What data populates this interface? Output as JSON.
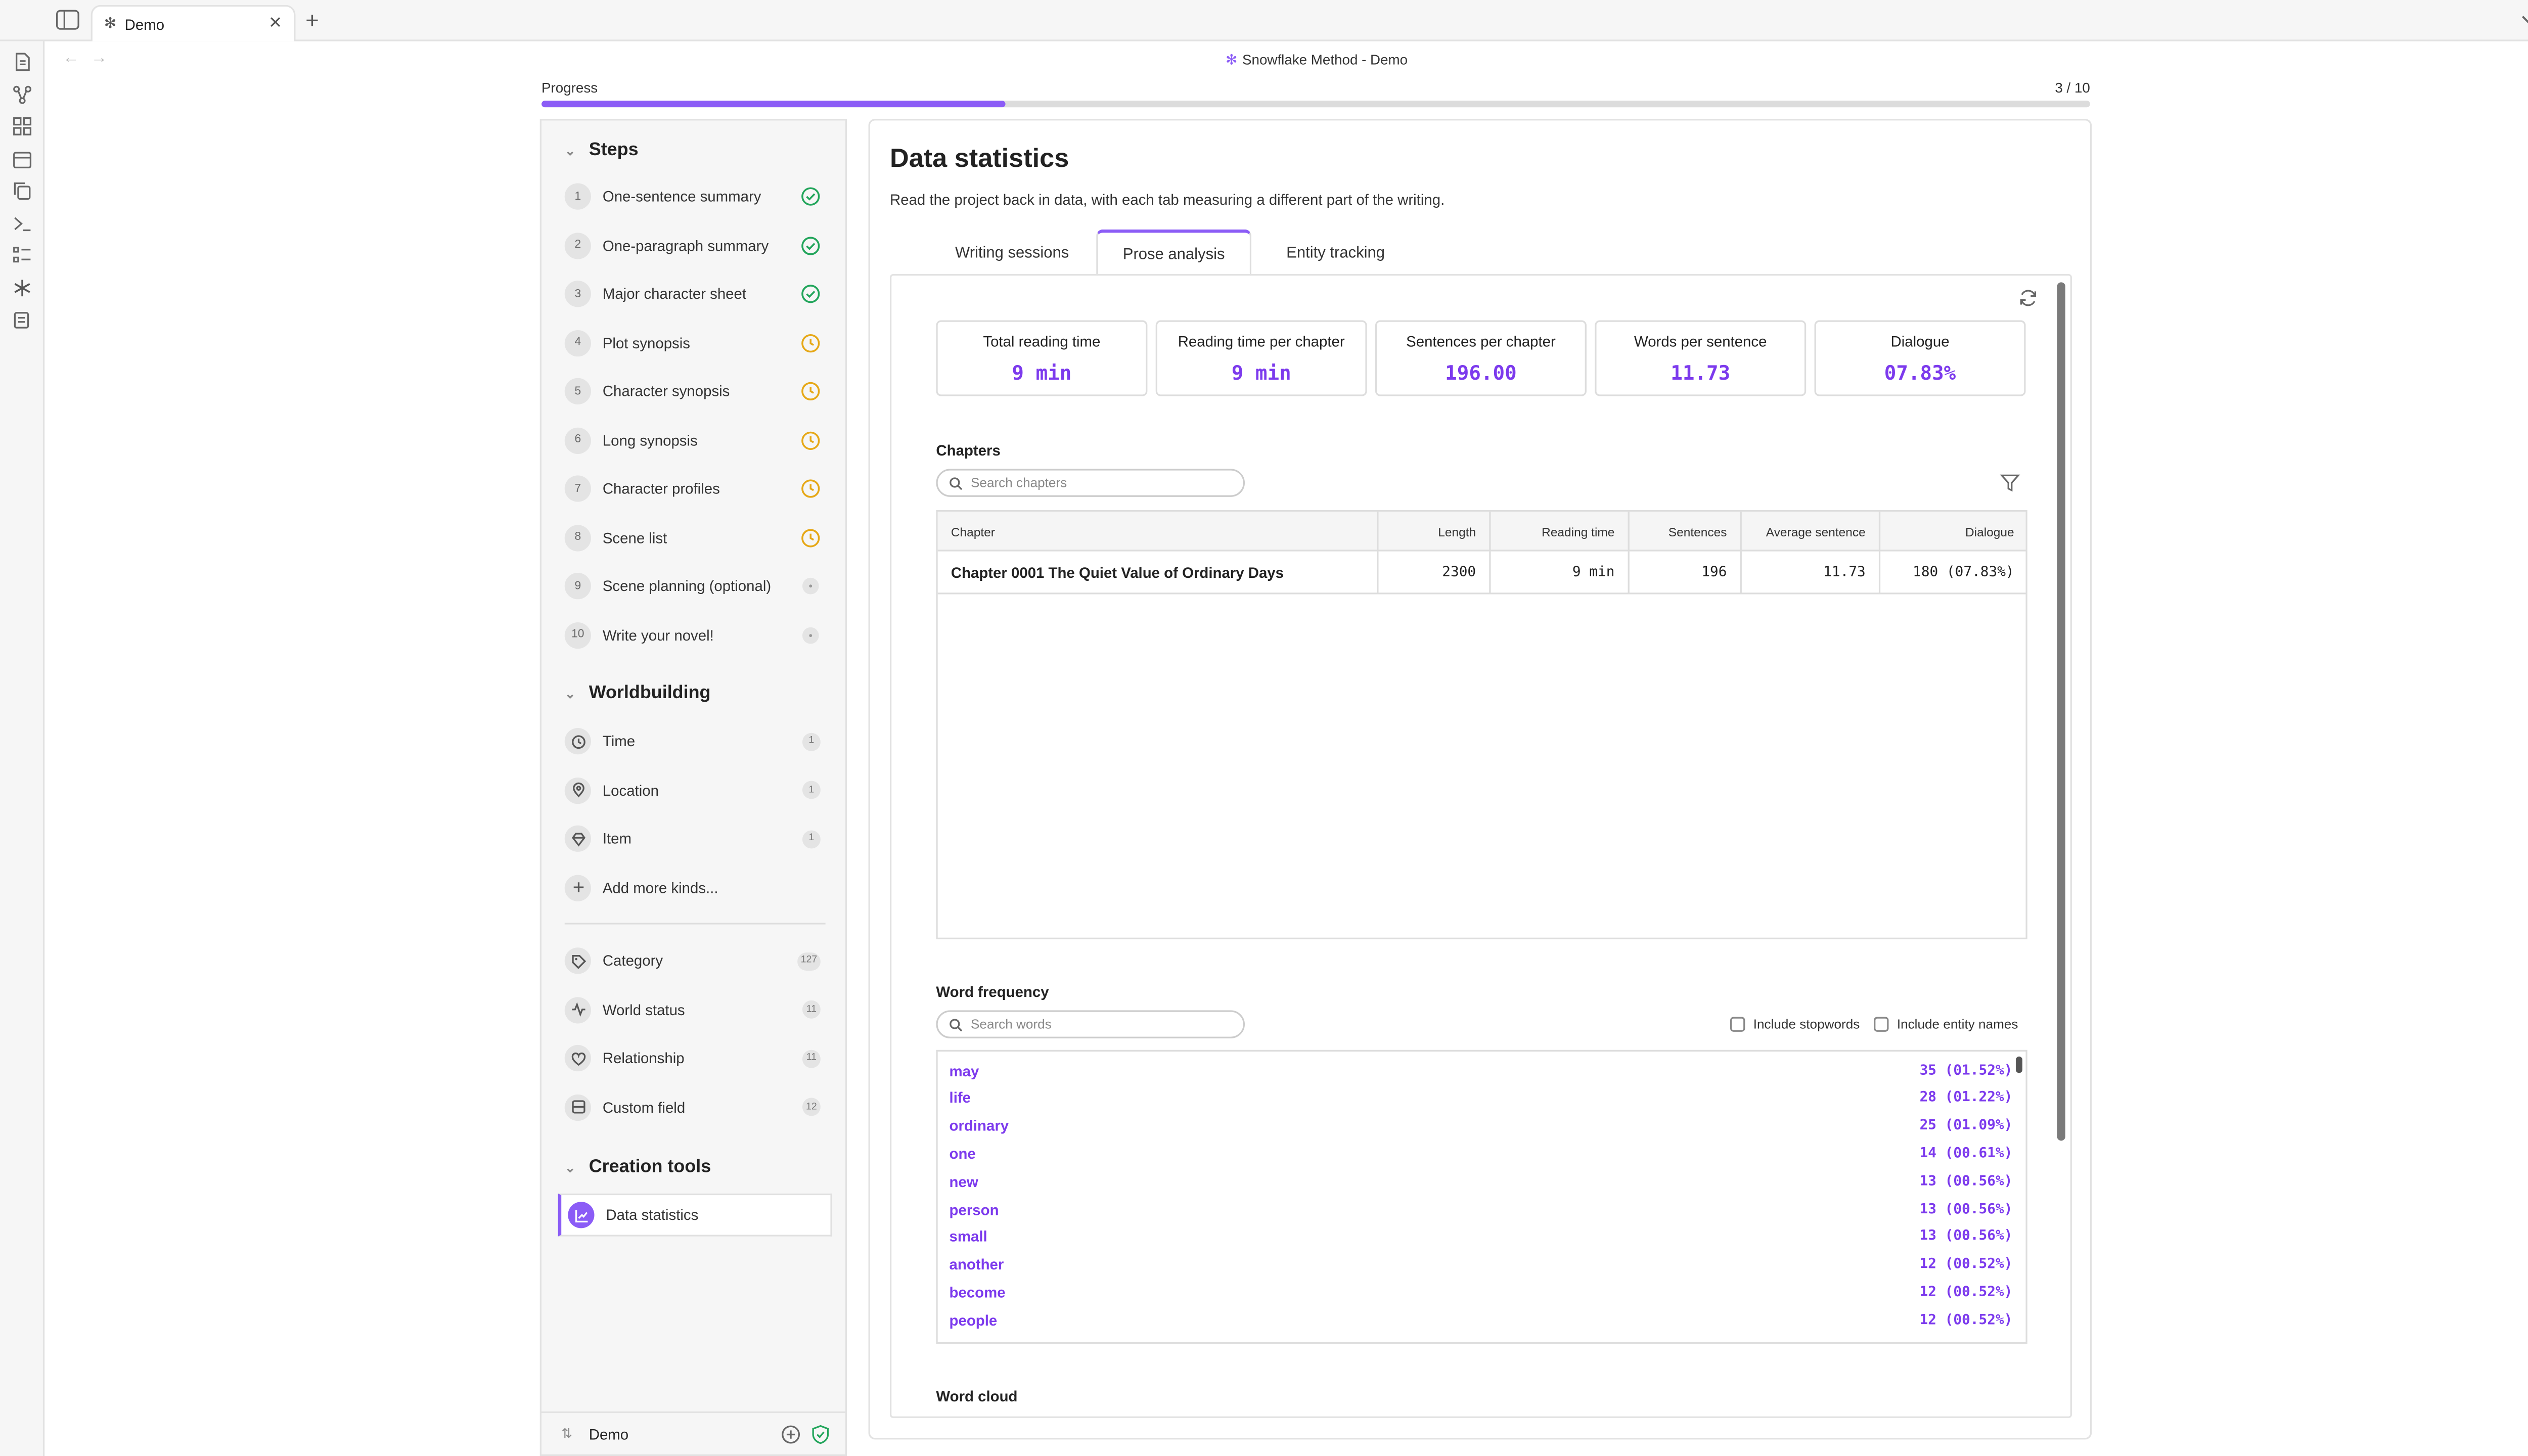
{
  "tabbar": {
    "tab_label": "Demo",
    "close": "✕",
    "new_tab": "+"
  },
  "window": {
    "title": "Snowflake Method - Demo"
  },
  "progress": {
    "label": "Progress",
    "count": "3 / 10",
    "fraction": 0.3
  },
  "sidebar": {
    "steps_title": "Steps",
    "steps": [
      {
        "num": "1",
        "label": "One-sentence summary",
        "status": "done"
      },
      {
        "num": "2",
        "label": "One-paragraph summary",
        "status": "done"
      },
      {
        "num": "3",
        "label": "Major character sheet",
        "status": "done"
      },
      {
        "num": "4",
        "label": "Plot synopsis",
        "status": "in-progress"
      },
      {
        "num": "5",
        "label": "Character synopsis",
        "status": "in-progress"
      },
      {
        "num": "6",
        "label": "Long synopsis",
        "status": "in-progress"
      },
      {
        "num": "7",
        "label": "Character profiles",
        "status": "in-progress"
      },
      {
        "num": "8",
        "label": "Scene list",
        "status": "in-progress"
      },
      {
        "num": "9",
        "label": "Scene planning (optional)",
        "status": "todo"
      },
      {
        "num": "10",
        "label": "Write your novel!",
        "status": "todo"
      }
    ],
    "world_title": "Worldbuilding",
    "world": [
      {
        "icon": "clock-icon",
        "label": "Time",
        "count": "1"
      },
      {
        "icon": "location-pin-icon",
        "label": "Location",
        "count": "1"
      },
      {
        "icon": "gem-icon",
        "label": "Item",
        "count": "1"
      },
      {
        "icon": "plus-icon",
        "label": "Add more kinds...",
        "count": ""
      }
    ],
    "meta": [
      {
        "icon": "tag-icon",
        "label": "Category",
        "count": "127"
      },
      {
        "icon": "activity-icon",
        "label": "World status",
        "count": "11"
      },
      {
        "icon": "heart-icon",
        "label": "Relationship",
        "count": "11"
      },
      {
        "icon": "field-icon",
        "label": "Custom field",
        "count": "12"
      }
    ],
    "tools_title": "Creation tools",
    "tools": [
      {
        "icon": "chart-icon",
        "label": "Data statistics"
      }
    ],
    "footer": {
      "vault": "Demo"
    }
  },
  "main": {
    "title": "Data statistics",
    "description": "Read the project back in data, with each tab measuring a different part of the writing.",
    "tabs": [
      "Writing sessions",
      "Prose analysis",
      "Entity tracking"
    ],
    "stats": [
      {
        "label": "Total reading time",
        "value": "9 min"
      },
      {
        "label": "Reading time per chapter",
        "value": "9 min"
      },
      {
        "label": "Sentences per chapter",
        "value": "196.00"
      },
      {
        "label": "Words per sentence",
        "value": "11.73"
      },
      {
        "label": "Dialogue",
        "value": "07.83%"
      }
    ],
    "chapters_title": "Chapters",
    "chapters_search_placeholder": "Search chapters",
    "chapter_columns": [
      "Chapter",
      "Length",
      "Reading time",
      "Sentences",
      "Average sentence",
      "Dialogue"
    ],
    "chapter_rows": [
      [
        "Chapter 0001 The Quiet Value of Ordinary Days",
        "2300",
        "9 min",
        "196",
        "11.73",
        "180 (07.83%)"
      ]
    ],
    "wordfreq_title": "Word frequency",
    "wordfreq_search_placeholder": "Search words",
    "include_stopwords": "Include stopwords",
    "include_entity_names": "Include entity names",
    "words": [
      {
        "word": "may",
        "count": "35 (01.52%)"
      },
      {
        "word": "life",
        "count": "28 (01.22%)"
      },
      {
        "word": "ordinary",
        "count": "25 (01.09%)"
      },
      {
        "word": "one",
        "count": "14 (00.61%)"
      },
      {
        "word": "new",
        "count": "13 (00.56%)"
      },
      {
        "word": "person",
        "count": "13 (00.56%)"
      },
      {
        "word": "small",
        "count": "13 (00.56%)"
      },
      {
        "word": "another",
        "count": "12 (00.52%)"
      },
      {
        "word": "become",
        "count": "12 (00.52%)"
      },
      {
        "word": "people",
        "count": "12 (00.52%)"
      }
    ],
    "wordcloud_title": "Word cloud"
  },
  "colors": {
    "accent": "#8b5cf6",
    "accent_text": "#7c3aed",
    "done": "#22a55b",
    "in_progress": "#e6a817"
  }
}
